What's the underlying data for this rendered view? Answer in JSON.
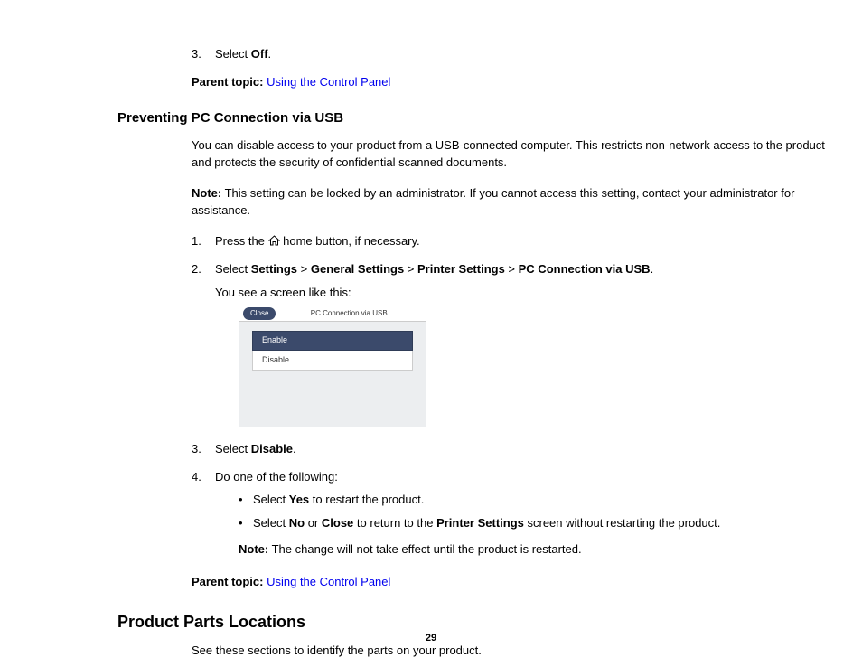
{
  "top": {
    "step3_num": "3.",
    "step3_pre": "Select ",
    "step3_bold": "Off",
    "step3_post": ".",
    "parent_label": "Parent topic:",
    "parent_link": "Using the Control Panel"
  },
  "section1": {
    "heading": "Preventing PC Connection via USB",
    "intro": "You can disable access to your product from a USB-connected computer. This restricts non-network access to the product and protects the security of confidential scanned documents.",
    "note_label": "Note:",
    "note_text": " This setting can be locked by an administrator. If you cannot access this setting, contact your administrator for assistance.",
    "steps": {
      "s1_num": "1.",
      "s1_pre": "Press the ",
      "s1_post": " home button, if necessary.",
      "s2_num": "2.",
      "s2_pre": "Select ",
      "s2_b1": "Settings",
      "s2_gt1": " > ",
      "s2_b2": "General Settings",
      "s2_gt2": " > ",
      "s2_b3": "Printer Settings",
      "s2_gt3": " > ",
      "s2_b4": "PC Connection via USB",
      "s2_end": ".",
      "s2_line2": "You see a screen like this:",
      "s3_num": "3.",
      "s3_pre": "Select ",
      "s3_bold": "Disable",
      "s3_post": ".",
      "s4_num": "4.",
      "s4_text": "Do one of the following:",
      "s4_b1_pre": "Select ",
      "s4_b1_bold": "Yes",
      "s4_b1_post": " to restart the product.",
      "s4_b2_pre": "Select ",
      "s4_b2_bold1": "No",
      "s4_b2_mid1": " or ",
      "s4_b2_bold2": "Close",
      "s4_b2_mid2": " to return to the ",
      "s4_b2_bold3": "Printer Settings",
      "s4_b2_post": " screen without restarting the product.",
      "s4_note_label": "Note:",
      "s4_note_text": " The change will not take effect until the product is restarted."
    },
    "screenshot": {
      "close": "Close",
      "title": "PC Connection via USB",
      "enable": "Enable",
      "disable": "Disable"
    },
    "parent_label": "Parent topic:",
    "parent_link": "Using the Control Panel"
  },
  "section2": {
    "heading": "Product Parts Locations",
    "intro": "See these sections to identify the parts on your product."
  },
  "page_number": "29"
}
